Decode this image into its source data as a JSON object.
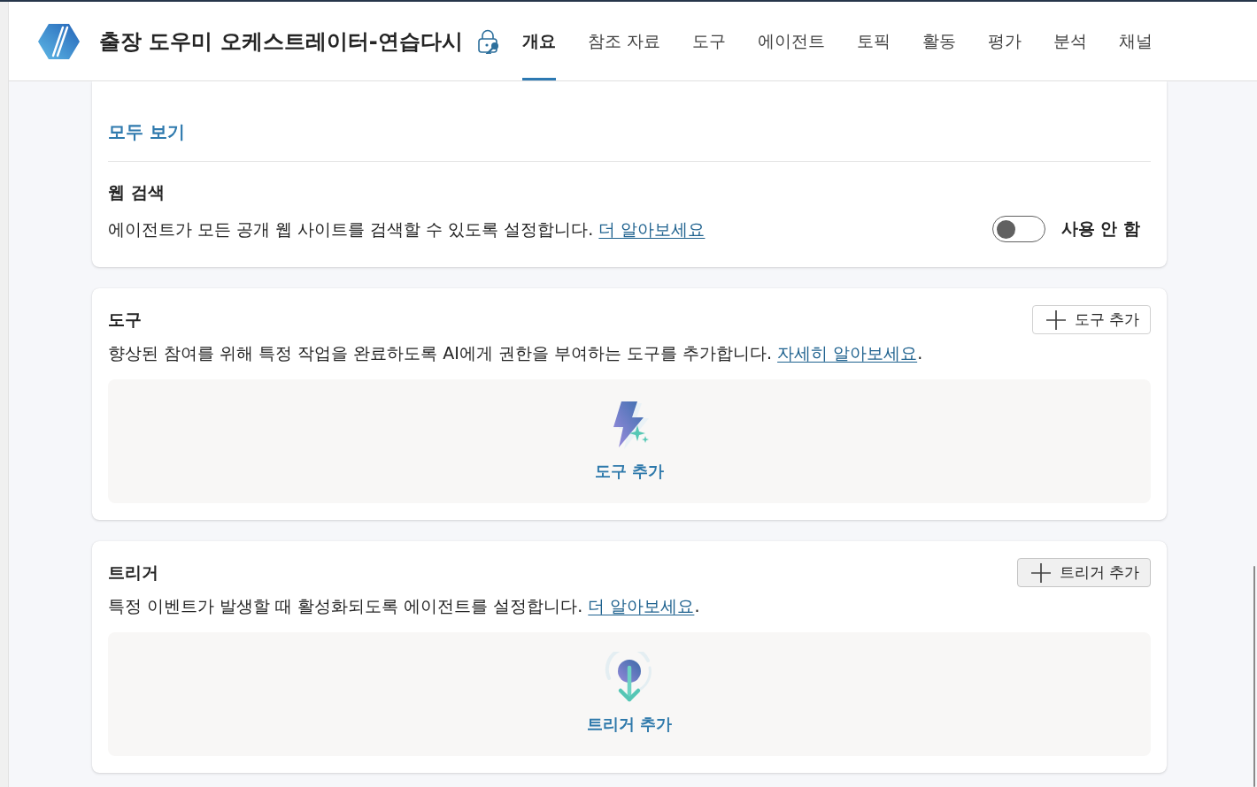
{
  "header": {
    "title": "출장 도우미 오케스트레이터-연습다시",
    "tabs": [
      {
        "label": "개요",
        "selected": true
      },
      {
        "label": "참조 자료",
        "selected": false
      },
      {
        "label": "도구",
        "selected": false
      },
      {
        "label": "에이전트",
        "selected": false
      },
      {
        "label": "토픽",
        "selected": false
      },
      {
        "label": "활동",
        "selected": false
      },
      {
        "label": "평가",
        "selected": false
      },
      {
        "label": "분석",
        "selected": false
      },
      {
        "label": "채널",
        "selected": false
      }
    ]
  },
  "knowledge_card": {
    "view_all_link": "모두 보기",
    "web_search": {
      "title": "웹 검색",
      "description": "에이전트가 모든 공개 웹 사이트를 검색할 수 있도록 설정합니다.",
      "link": "더 알아보세요",
      "toggle": {
        "on": false,
        "label": "사용 안 함"
      }
    }
  },
  "cards": [
    {
      "kind": "tools",
      "title": "도구",
      "description": "향상된 참여를 위해 특정 작업을 완료하도록 AI에게 권한을 부여하는 도구를 추가합니다.",
      "link": "자세히 알아보세요",
      "link_suffix": ".",
      "add_button": {
        "label": "도구 추가",
        "hovered": false
      },
      "empty_state_label": "도구 추가"
    },
    {
      "kind": "triggers",
      "title": "트리거",
      "description": "특정 이벤트가 발생할 때 활성화되도록 에이전트를 설정합니다.",
      "link": "더 알아보세요",
      "link_suffix": ".",
      "add_button": {
        "label": "트리거 추가",
        "hovered": true
      },
      "empty_state_label": "트리거 추가"
    }
  ]
}
